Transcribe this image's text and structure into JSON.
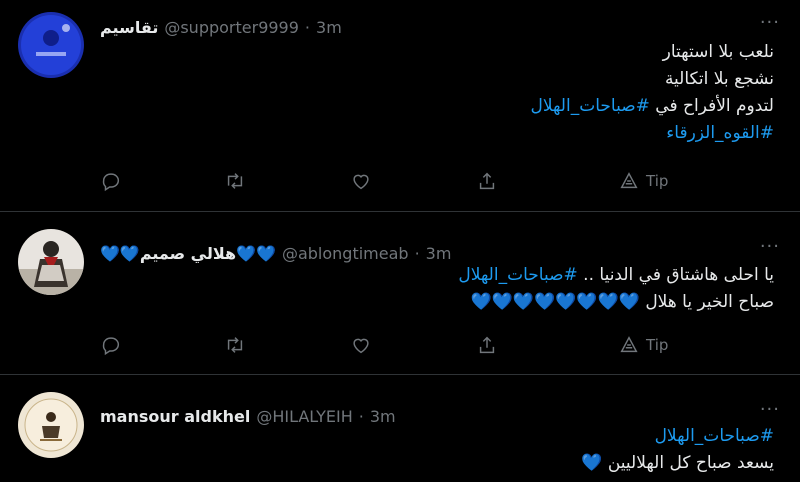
{
  "tweets": [
    {
      "name": "تقاسيم",
      "handle": "@supporter9999",
      "sep": "·",
      "time": "3m",
      "lines": [
        {
          "text": "نلعب بلا استهتار",
          "type": "text"
        },
        {
          "text": "نشجع بلا اتكالية",
          "type": "text"
        },
        {
          "text": "لتدوم الأفراح في",
          "type": "mixed",
          "hashtag": "#صباحات_الهلال"
        },
        {
          "text": "#القوه_الزرقاء",
          "type": "hashtag"
        }
      ],
      "tip_label": "Tip"
    },
    {
      "name": "💙💙هلالي صميم💙💙",
      "handle": "@ablongtimeab",
      "sep": "·",
      "time": "3m",
      "lines": [
        {
          "text": "يا احلى هاشتاق في الدنيا ..",
          "type": "mixed",
          "hashtag": "#صباحات_الهلال"
        },
        {
          "text": "صباح الخير يا هلال",
          "type": "hearts",
          "hearts": "💙💙💙💙💙💙💙💙"
        }
      ],
      "tip_label": "Tip"
    },
    {
      "name": "mansour aldkhel",
      "handle": "@HILALYEIH",
      "sep": "·",
      "time": "3m",
      "lines": [
        {
          "text": "#صباحات_الهلال",
          "type": "hashtag"
        },
        {
          "text": "يسعد صباح كل الهلاليين",
          "type": "hearts",
          "hearts": "💙"
        }
      ]
    }
  ],
  "more_label": "···",
  "icons": [
    "reply-icon",
    "retweet-icon",
    "like-icon",
    "share-icon",
    "tip-icon"
  ],
  "colors": {
    "background": "#000000",
    "hashtag": "#1d9bf0",
    "secondary": "#71767b",
    "divider": "#2f3336"
  }
}
